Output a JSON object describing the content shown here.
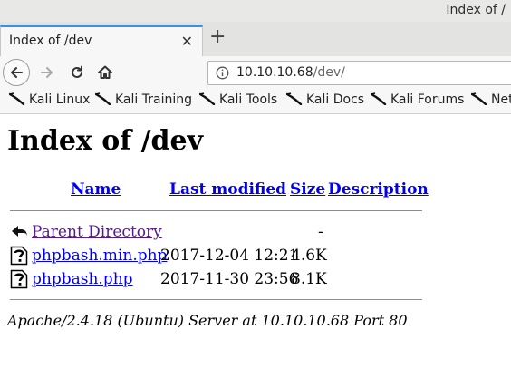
{
  "window": {
    "title": "Index of /"
  },
  "tab": {
    "title": "Index of /dev"
  },
  "address": {
    "host": "10.10.10.68",
    "path": "/dev/"
  },
  "bookmarks": [
    "Kali Linux",
    "Kali Training",
    "Kali Tools",
    "Kali Docs",
    "Kali Forums",
    "Net"
  ],
  "page": {
    "heading": "Index of /dev",
    "columns": {
      "name": "Name",
      "modified": "Last modified",
      "size": "Size",
      "description": "Description"
    },
    "parent": {
      "name": "Parent Directory",
      "size": "-"
    },
    "files": [
      {
        "name": "phpbash.min.php",
        "modified": "2017-12-04 12:21",
        "size": "4.6K"
      },
      {
        "name": "phpbash.php",
        "modified": "2017-11-30 23:56",
        "size": "8.1K"
      }
    ],
    "footer": "Apache/2.4.18 (Ubuntu) Server at 10.10.10.68 Port 80"
  }
}
